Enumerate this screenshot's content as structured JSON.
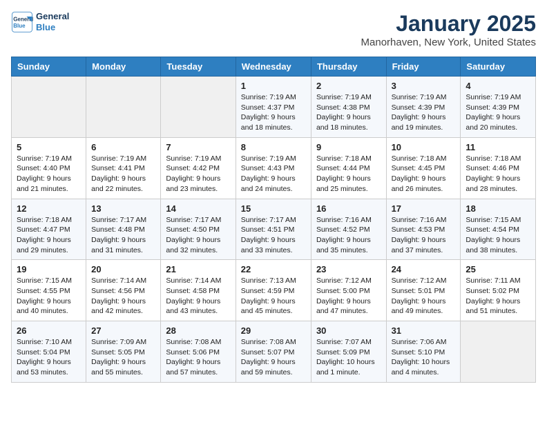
{
  "header": {
    "logo_line1": "General",
    "logo_line2": "Blue",
    "month": "January 2025",
    "location": "Manorhaven, New York, United States"
  },
  "weekdays": [
    "Sunday",
    "Monday",
    "Tuesday",
    "Wednesday",
    "Thursday",
    "Friday",
    "Saturday"
  ],
  "weeks": [
    [
      {
        "day": "",
        "info": ""
      },
      {
        "day": "",
        "info": ""
      },
      {
        "day": "",
        "info": ""
      },
      {
        "day": "1",
        "info": "Sunrise: 7:19 AM\nSunset: 4:37 PM\nDaylight: 9 hours and 18 minutes."
      },
      {
        "day": "2",
        "info": "Sunrise: 7:19 AM\nSunset: 4:38 PM\nDaylight: 9 hours and 18 minutes."
      },
      {
        "day": "3",
        "info": "Sunrise: 7:19 AM\nSunset: 4:39 PM\nDaylight: 9 hours and 19 minutes."
      },
      {
        "day": "4",
        "info": "Sunrise: 7:19 AM\nSunset: 4:39 PM\nDaylight: 9 hours and 20 minutes."
      }
    ],
    [
      {
        "day": "5",
        "info": "Sunrise: 7:19 AM\nSunset: 4:40 PM\nDaylight: 9 hours and 21 minutes."
      },
      {
        "day": "6",
        "info": "Sunrise: 7:19 AM\nSunset: 4:41 PM\nDaylight: 9 hours and 22 minutes."
      },
      {
        "day": "7",
        "info": "Sunrise: 7:19 AM\nSunset: 4:42 PM\nDaylight: 9 hours and 23 minutes."
      },
      {
        "day": "8",
        "info": "Sunrise: 7:19 AM\nSunset: 4:43 PM\nDaylight: 9 hours and 24 minutes."
      },
      {
        "day": "9",
        "info": "Sunrise: 7:18 AM\nSunset: 4:44 PM\nDaylight: 9 hours and 25 minutes."
      },
      {
        "day": "10",
        "info": "Sunrise: 7:18 AM\nSunset: 4:45 PM\nDaylight: 9 hours and 26 minutes."
      },
      {
        "day": "11",
        "info": "Sunrise: 7:18 AM\nSunset: 4:46 PM\nDaylight: 9 hours and 28 minutes."
      }
    ],
    [
      {
        "day": "12",
        "info": "Sunrise: 7:18 AM\nSunset: 4:47 PM\nDaylight: 9 hours and 29 minutes."
      },
      {
        "day": "13",
        "info": "Sunrise: 7:17 AM\nSunset: 4:48 PM\nDaylight: 9 hours and 31 minutes."
      },
      {
        "day": "14",
        "info": "Sunrise: 7:17 AM\nSunset: 4:50 PM\nDaylight: 9 hours and 32 minutes."
      },
      {
        "day": "15",
        "info": "Sunrise: 7:17 AM\nSunset: 4:51 PM\nDaylight: 9 hours and 33 minutes."
      },
      {
        "day": "16",
        "info": "Sunrise: 7:16 AM\nSunset: 4:52 PM\nDaylight: 9 hours and 35 minutes."
      },
      {
        "day": "17",
        "info": "Sunrise: 7:16 AM\nSunset: 4:53 PM\nDaylight: 9 hours and 37 minutes."
      },
      {
        "day": "18",
        "info": "Sunrise: 7:15 AM\nSunset: 4:54 PM\nDaylight: 9 hours and 38 minutes."
      }
    ],
    [
      {
        "day": "19",
        "info": "Sunrise: 7:15 AM\nSunset: 4:55 PM\nDaylight: 9 hours and 40 minutes."
      },
      {
        "day": "20",
        "info": "Sunrise: 7:14 AM\nSunset: 4:56 PM\nDaylight: 9 hours and 42 minutes."
      },
      {
        "day": "21",
        "info": "Sunrise: 7:14 AM\nSunset: 4:58 PM\nDaylight: 9 hours and 43 minutes."
      },
      {
        "day": "22",
        "info": "Sunrise: 7:13 AM\nSunset: 4:59 PM\nDaylight: 9 hours and 45 minutes."
      },
      {
        "day": "23",
        "info": "Sunrise: 7:12 AM\nSunset: 5:00 PM\nDaylight: 9 hours and 47 minutes."
      },
      {
        "day": "24",
        "info": "Sunrise: 7:12 AM\nSunset: 5:01 PM\nDaylight: 9 hours and 49 minutes."
      },
      {
        "day": "25",
        "info": "Sunrise: 7:11 AM\nSunset: 5:02 PM\nDaylight: 9 hours and 51 minutes."
      }
    ],
    [
      {
        "day": "26",
        "info": "Sunrise: 7:10 AM\nSunset: 5:04 PM\nDaylight: 9 hours and 53 minutes."
      },
      {
        "day": "27",
        "info": "Sunrise: 7:09 AM\nSunset: 5:05 PM\nDaylight: 9 hours and 55 minutes."
      },
      {
        "day": "28",
        "info": "Sunrise: 7:08 AM\nSunset: 5:06 PM\nDaylight: 9 hours and 57 minutes."
      },
      {
        "day": "29",
        "info": "Sunrise: 7:08 AM\nSunset: 5:07 PM\nDaylight: 9 hours and 59 minutes."
      },
      {
        "day": "30",
        "info": "Sunrise: 7:07 AM\nSunset: 5:09 PM\nDaylight: 10 hours and 1 minute."
      },
      {
        "day": "31",
        "info": "Sunrise: 7:06 AM\nSunset: 5:10 PM\nDaylight: 10 hours and 4 minutes."
      },
      {
        "day": "",
        "info": ""
      }
    ]
  ]
}
